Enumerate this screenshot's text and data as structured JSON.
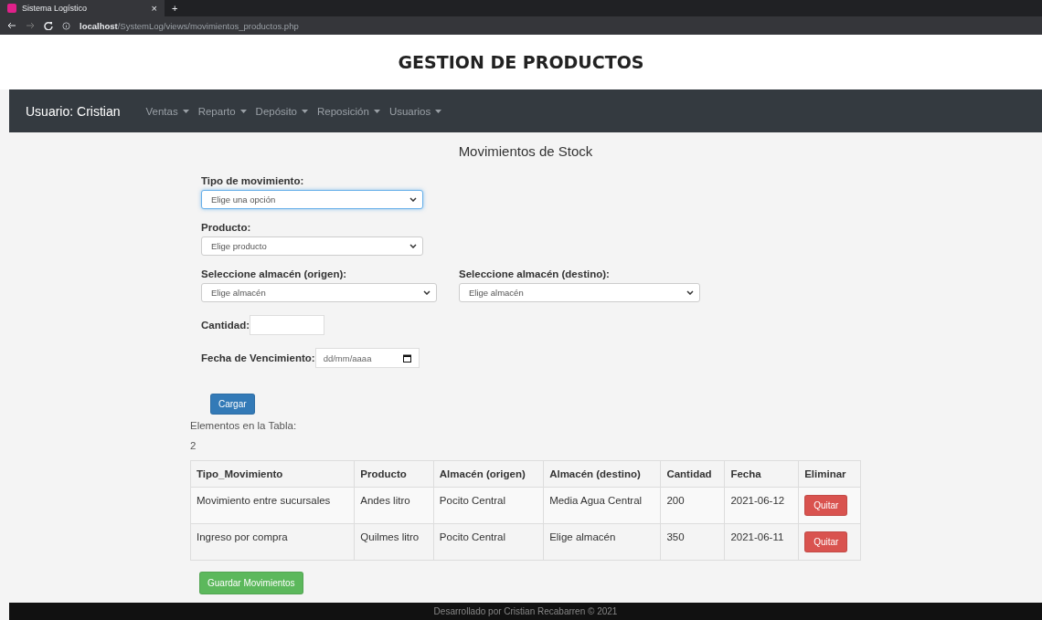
{
  "browser": {
    "tab_title": "Sistema Logístico",
    "tab_close": "×",
    "new_tab": "+",
    "url_host": "localhost",
    "url_path": "/SystemLog/views/movimientos_productos.php"
  },
  "header": {
    "title": "GESTION DE PRODUCTOS"
  },
  "navbar": {
    "user": "Usuario: Cristian",
    "menus": [
      "Ventas",
      "Reparto",
      "Depósito",
      "Reposición",
      "Usuarios"
    ]
  },
  "page_title": "Movimientos de Stock",
  "form": {
    "tipo": {
      "label": "Tipo de movimiento:",
      "value": "Elige una opción",
      "focused": true
    },
    "producto": {
      "label": "Producto:",
      "value": "Elige producto",
      "focused": false
    },
    "origen": {
      "label": "Seleccione almacén (origen):",
      "value": "Elige almacén",
      "focused": false
    },
    "destino": {
      "label": "Seleccione almacén (destino):",
      "value": "Elige almacén",
      "focused": false
    },
    "cantidad": {
      "label": "Cantidad:"
    },
    "fecha": {
      "label": "Fecha de Vencimiento:",
      "placeholder": "dd/mm/aaaa"
    },
    "submit": "Cargar"
  },
  "count_label": "Elementos en la Tabla:",
  "count": "2",
  "table": {
    "columns": [
      "Tipo_Movimiento",
      "Producto",
      "Almacén (origen)",
      "Almacén (destino)",
      "Cantidad",
      "Fecha",
      "Eliminar"
    ],
    "rows": [
      {
        "cells": [
          "Movimiento entre sucursales",
          "Andes litro",
          "Pocito Central",
          "Media Agua Central",
          "200",
          "2021-06-12"
        ],
        "action": "Quitar"
      },
      {
        "cells": [
          "Ingreso por compra",
          "Quilmes litro",
          "Pocito Central",
          "Elige almacén",
          "350",
          "2021-06-11"
        ],
        "action": "Quitar"
      }
    ]
  },
  "save_button": "Guardar Movimientos",
  "footer": "Desarrollado por Cristian Recabarren © 2021"
}
